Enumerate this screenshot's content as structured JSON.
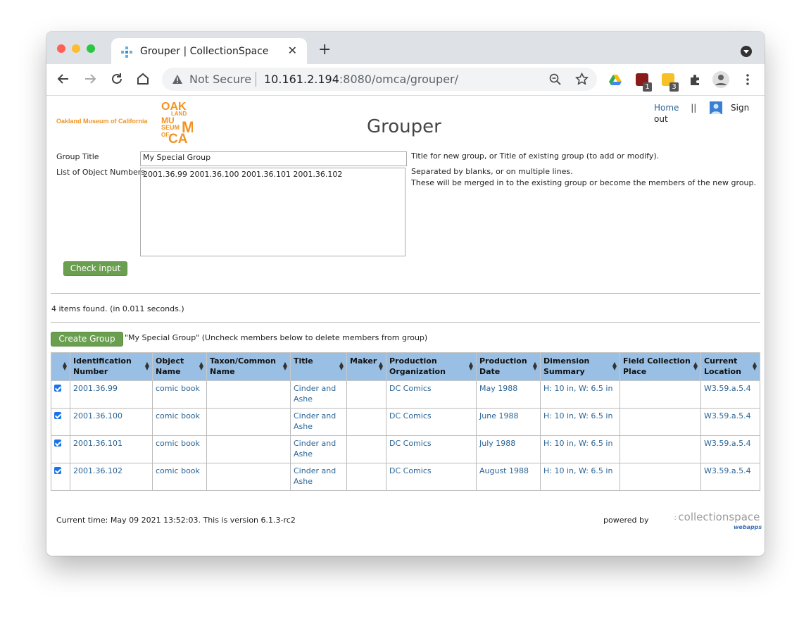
{
  "browser": {
    "tab_title": "Grouper | CollectionSpace",
    "tab_close": "✕",
    "new_tab": "+",
    "security_label": "Not Secure",
    "url_host": "10.161.2.194",
    "url_rest": ":8080/omca/grouper/",
    "ext_badges": [
      "1",
      "3"
    ]
  },
  "header": {
    "org_name": "Oakland Museum of California",
    "logo_lines": [
      "OAK",
      "LAND",
      "MU",
      "SEUM",
      "OF",
      "CA"
    ],
    "page_title": "Grouper",
    "nav_home": "Home",
    "nav_sep": "||",
    "nav_signout": "Sign out"
  },
  "form": {
    "group_title_label": "Group Title",
    "group_title_value": "My Special Group",
    "group_title_help": "Title for new group, or Title of existing group (to add or modify).",
    "objects_label": "List of Object Numbers",
    "objects_value": "2001.36.99 2001.36.100 2001.36.101 2001.36.102",
    "objects_help_1": "Separated by blanks, or on multiple lines.",
    "objects_help_2": "These will be merged in to the existing group or become the members of the new group.",
    "check_button": "Check input"
  },
  "results": {
    "found_text": "4 items found. (in 0.011 seconds.)",
    "create_button": "Create Group",
    "create_note": "\"My Special Group\" (Uncheck members below to delete members from group)",
    "columns": [
      [
        "Identification",
        "Number"
      ],
      [
        "Object",
        "Name"
      ],
      [
        "Taxon/Common",
        "Name"
      ],
      [
        "Title",
        ""
      ],
      [
        "Maker",
        ""
      ],
      [
        "Production",
        "Organization"
      ],
      [
        "Production",
        "Date"
      ],
      [
        "Dimension",
        "Summary"
      ],
      [
        "Field Collection",
        "Place"
      ],
      [
        "Current",
        "Location"
      ]
    ],
    "rows": [
      {
        "id": "2001.36.99",
        "object_name": "comic book",
        "taxon": "",
        "title_1": "Cinder and",
        "title_2": "Ashe",
        "maker": "",
        "org": "DC Comics",
        "date": "May 1988",
        "dim": "H: 10 in, W: 6.5 in",
        "place": "",
        "location": "W3.59.a.5.4"
      },
      {
        "id": "2001.36.100",
        "object_name": "comic book",
        "taxon": "",
        "title_1": "Cinder and",
        "title_2": "Ashe",
        "maker": "",
        "org": "DC Comics",
        "date": "June 1988",
        "dim": "H: 10 in, W: 6.5 in",
        "place": "",
        "location": "W3.59.a.5.4"
      },
      {
        "id": "2001.36.101",
        "object_name": "comic book",
        "taxon": "",
        "title_1": "Cinder and",
        "title_2": "Ashe",
        "maker": "",
        "org": "DC Comics",
        "date": "July 1988",
        "dim": "H: 10 in, W: 6.5 in",
        "place": "",
        "location": "W3.59.a.5.4"
      },
      {
        "id": "2001.36.102",
        "object_name": "comic book",
        "taxon": "",
        "title_1": "Cinder and",
        "title_2": "Ashe",
        "maker": "",
        "org": "DC Comics",
        "date": "August 1988",
        "dim": "H: 10 in, W: 6.5 in",
        "place": "",
        "location": "W3.59.a.5.4"
      }
    ]
  },
  "footer": {
    "status": "Current time: May 09 2021 13:52:03. This is version 6.1.3-rc2",
    "powered_by": "powered by",
    "cs_logo": "collectionspace",
    "cs_sub": "webapps"
  },
  "colors": {
    "accent_orange": "#f29423",
    "button_green": "#6a9f4f",
    "table_header_blue": "#99c0e4",
    "link_blue": "#2a6496"
  }
}
